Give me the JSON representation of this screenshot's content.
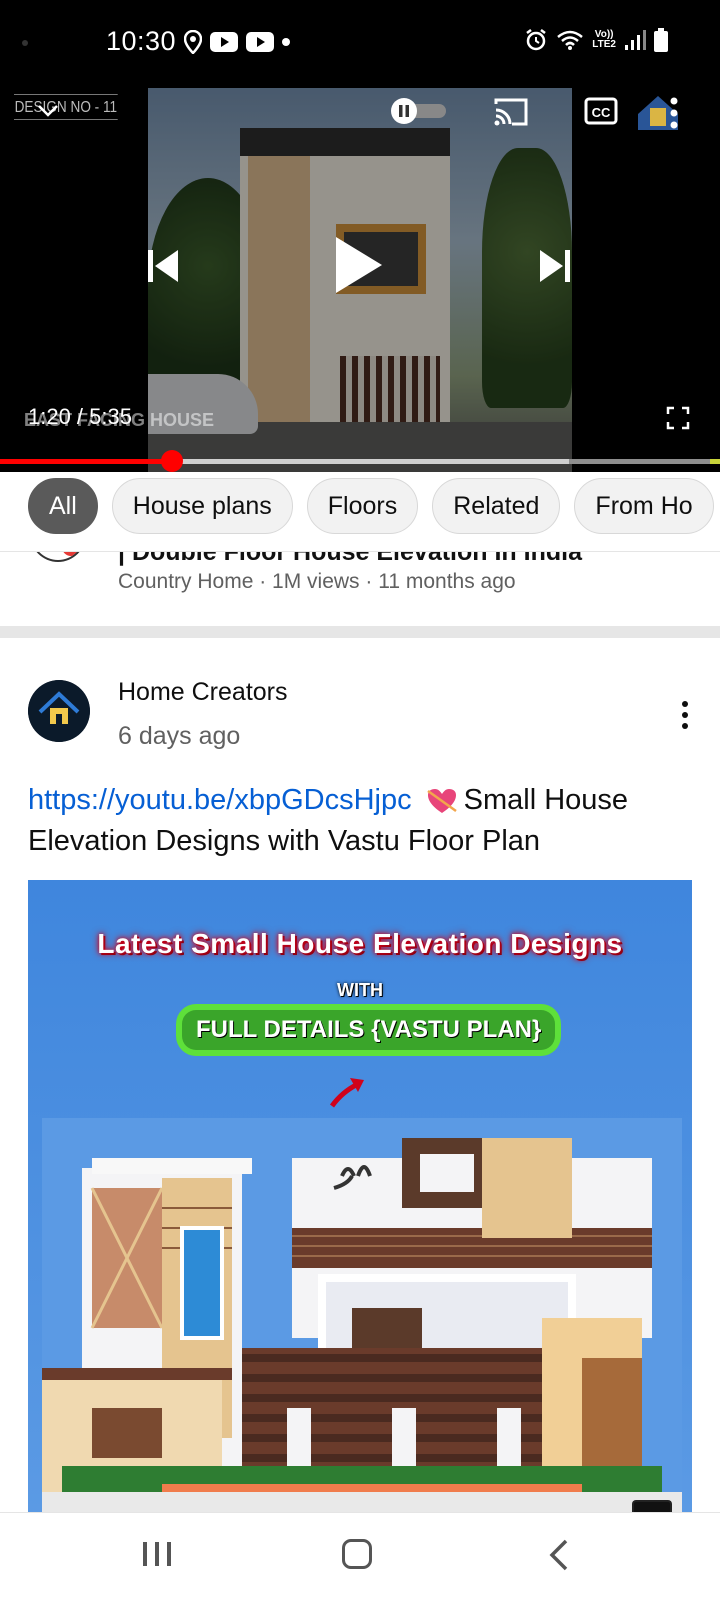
{
  "status_bar": {
    "time": "10:30",
    "left_icons": [
      "location-icon",
      "youtube-icon",
      "youtube-icon",
      "dot"
    ],
    "right_icons": [
      "alarm-icon",
      "wifi-icon",
      "volte-icon",
      "signal-icon",
      "battery-icon"
    ],
    "volte_label_top": "Vo))",
    "volte_label_bottom": "LTE2"
  },
  "player": {
    "video_overlay_label": "DESIGN NO - 11",
    "watermark": "EAST FACING HOUSE",
    "time_readout": "1:20 / 5:35",
    "progress_fraction": 0.239,
    "buffer_fraction": 0.79,
    "state": "paused",
    "icons": [
      "collapse-icon",
      "pause-toggle-icon",
      "cast-icon",
      "cc-icon",
      "more-icon",
      "previous-icon",
      "play-icon",
      "next-icon",
      "fullscreen-icon"
    ]
  },
  "chips": [
    {
      "label": "All",
      "active": true
    },
    {
      "label": "House plans",
      "active": false
    },
    {
      "label": "Floors",
      "active": false
    },
    {
      "label": "Related",
      "active": false
    },
    {
      "label": "From Ho",
      "active": false
    }
  ],
  "previous_item": {
    "title_fragment": "| Double Floor House Elevation In India",
    "meta": "Country Home · 1M views · 11 months ago"
  },
  "post": {
    "channel": "Home Creators",
    "date": "6 days ago",
    "link": "https://youtu.be/xbpGDcsHjpc",
    "text_after_link": "Small House Elevation Designs with Vastu Floor Plan",
    "image": {
      "headline": "Latest Small House Elevation Designs",
      "with": "WITH",
      "subheadline": "FULL DETAILS {VASTU PLAN}"
    }
  },
  "navigation": [
    "recents-icon",
    "home-icon",
    "back-icon"
  ],
  "colors": {
    "accent_red": "#ff0000",
    "link_blue": "#065fd4",
    "chip_active_bg": "#5a5a5a",
    "post_image_bg": "#3f86dd"
  }
}
